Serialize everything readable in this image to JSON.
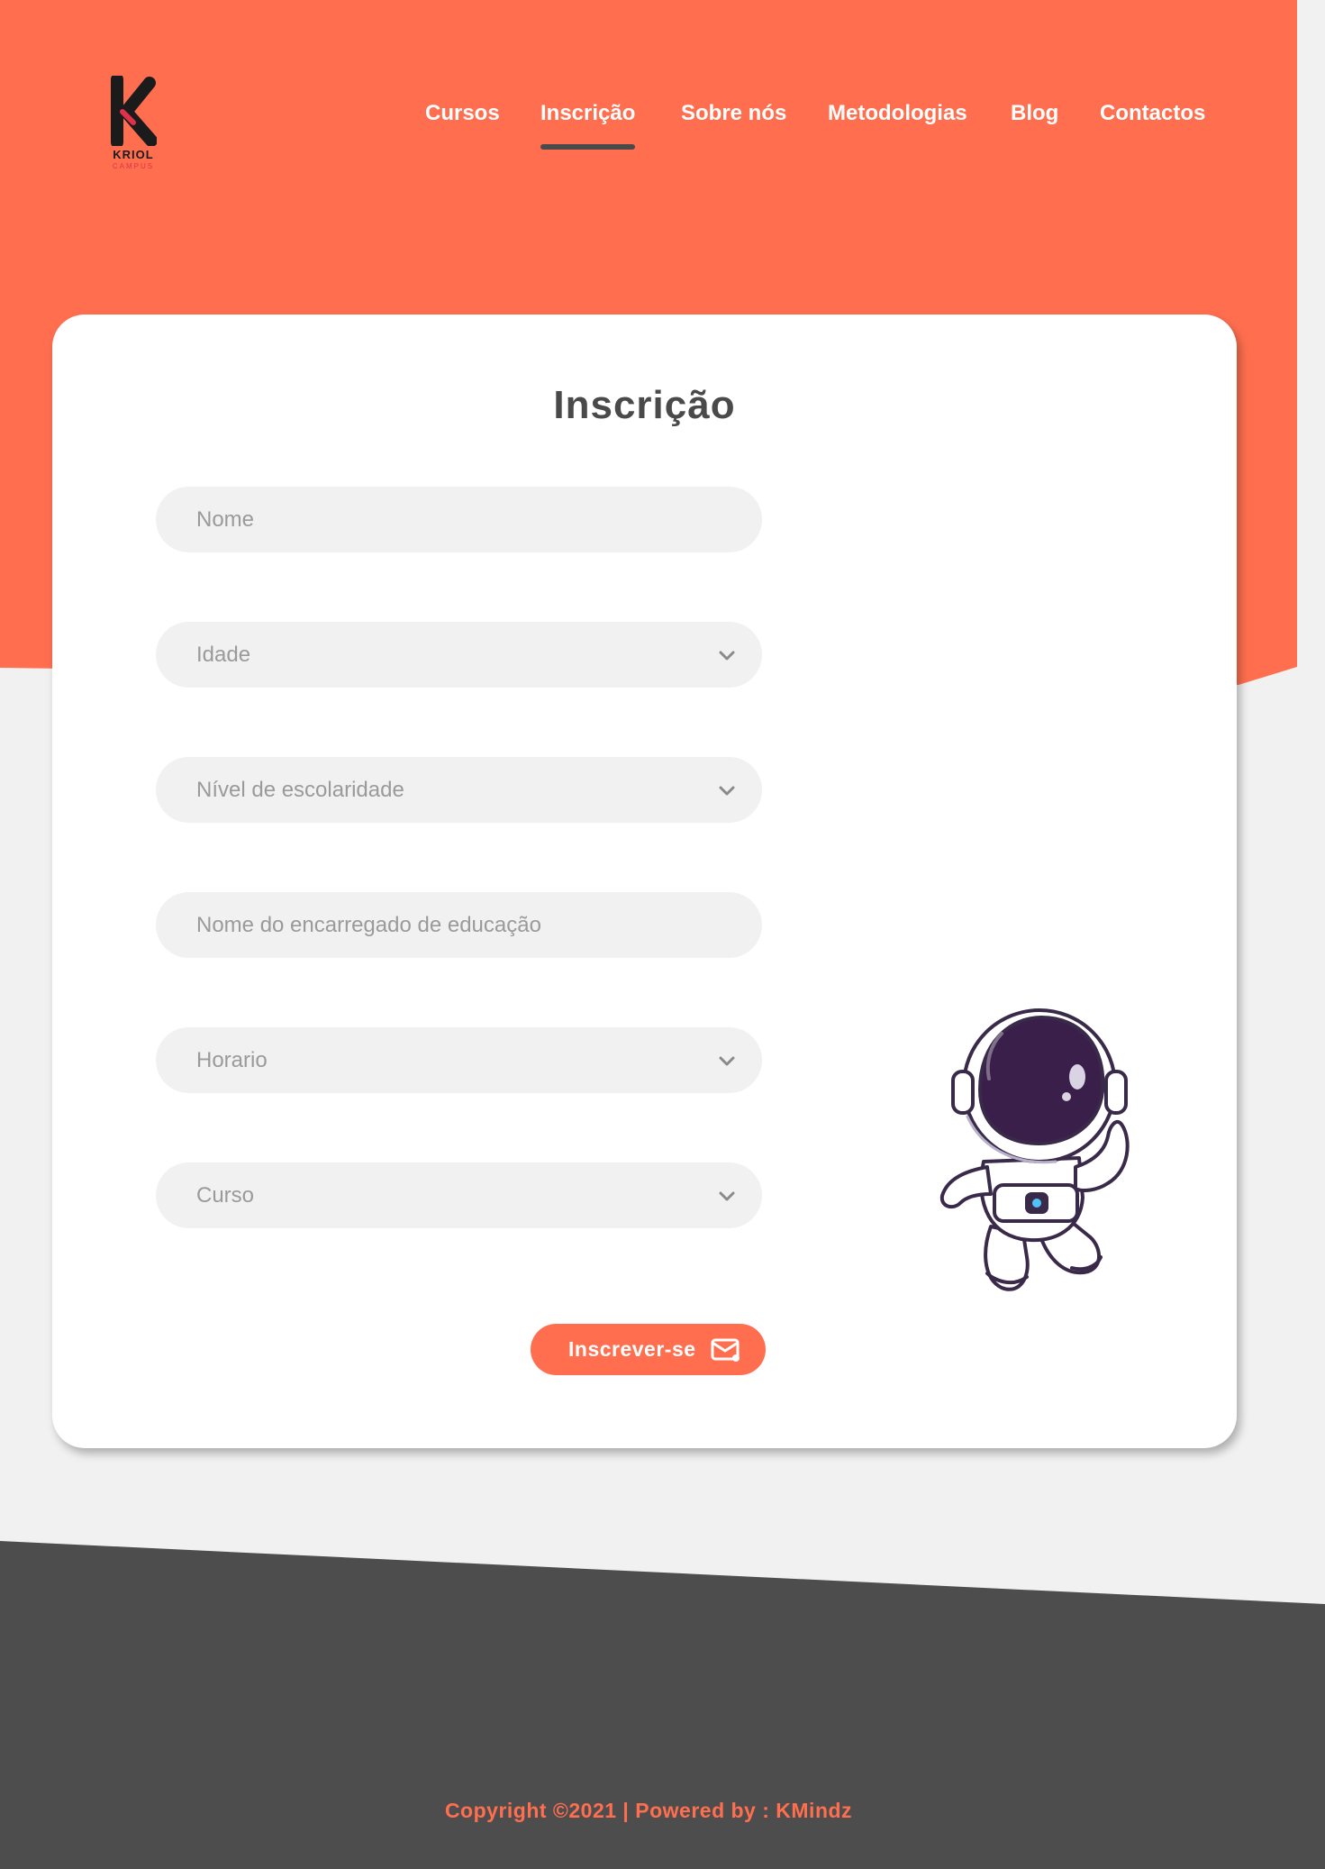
{
  "brand": {
    "name": "KRIOL",
    "sub": "CAMPUS",
    "accent": "#ff6f4f",
    "dark": "#4a4a4a",
    "logo_red": "#e0314a"
  },
  "nav": {
    "items": [
      {
        "label": "Cursos",
        "active": false
      },
      {
        "label": "Inscrição",
        "active": true
      },
      {
        "label": "Sobre nós",
        "active": false
      },
      {
        "label": "Metodologias",
        "active": false
      },
      {
        "label": "Blog",
        "active": false
      },
      {
        "label": "Contactos",
        "active": false
      }
    ]
  },
  "form": {
    "title": "Inscrição",
    "fields": [
      {
        "placeholder": "Nome",
        "type": "text-input"
      },
      {
        "placeholder": "Idade",
        "type": "select",
        "icon": "chevron-down-icon"
      },
      {
        "placeholder": "Nível de escolaridade",
        "type": "select",
        "icon": "chevron-down-icon"
      },
      {
        "placeholder": "Nome do encarregado de educação",
        "type": "text-input"
      },
      {
        "placeholder": "Horario",
        "type": "select",
        "icon": "chevron-down-icon"
      },
      {
        "placeholder": "Curso",
        "type": "select",
        "icon": "chevron-down-icon"
      }
    ],
    "submit": {
      "label": "Inscrever-se",
      "icon": "envelope-icon"
    }
  },
  "illustration": {
    "icon": "astronaut-illustration"
  },
  "footer": {
    "copyright": "Copyright ©2021 | Powered by : KMindz"
  }
}
